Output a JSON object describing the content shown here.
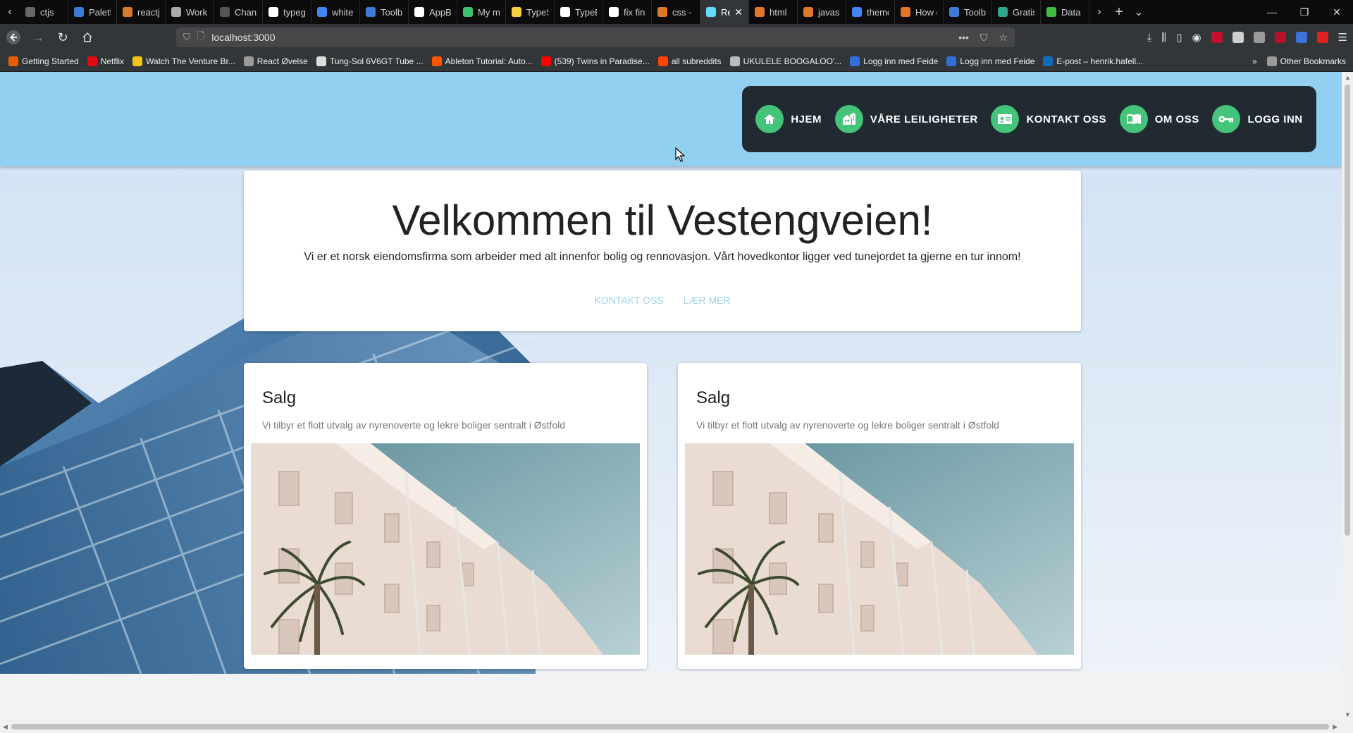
{
  "browser": {
    "tabs": [
      {
        "title": "ctjs",
        "color": "#666666"
      },
      {
        "title": "Palette",
        "color": "#3d7bd9"
      },
      {
        "title": "reactjs",
        "color": "#d97b2d"
      },
      {
        "title": "Work",
        "color": "#aaaaaa"
      },
      {
        "title": "Changelog",
        "color": "#555555"
      },
      {
        "title": "typeg",
        "color": "#ffffff"
      },
      {
        "title": "white",
        "color": "#4285f4"
      },
      {
        "title": "Toolb",
        "color": "#3d7bd9"
      },
      {
        "title": "AppB",
        "color": "#ffffff"
      },
      {
        "title": "My m",
        "color": "#3fbf6f"
      },
      {
        "title": "TypeS",
        "color": "#f5d142"
      },
      {
        "title": "TypeE",
        "color": "#ffffff"
      },
      {
        "title": "fix fin",
        "color": "#ffffff"
      },
      {
        "title": "css - h",
        "color": "#e0782a"
      },
      {
        "title": "Re",
        "color": "#61dafb",
        "active": true
      },
      {
        "title": "html",
        "color": "#e0782a"
      },
      {
        "title": "javasc",
        "color": "#e0782a"
      },
      {
        "title": "theme",
        "color": "#4285f4"
      },
      {
        "title": "How c",
        "color": "#e0782a"
      },
      {
        "title": "Toolb",
        "color": "#3d7bd9"
      },
      {
        "title": "Gratis",
        "color": "#2ea88a"
      },
      {
        "title": "Data |",
        "color": "#3fbf3f"
      }
    ],
    "url": "localhost:3000",
    "bookmarks": [
      {
        "label": "Getting Started",
        "color": "#e66000"
      },
      {
        "label": "Netflix",
        "color": "#e50914"
      },
      {
        "label": "Watch The Venture Br...",
        "color": "#f2c318"
      },
      {
        "label": "React Øvelse",
        "color": "#9a9a9a"
      },
      {
        "label": "Tung-Sol 6V6GT Tube ...",
        "color": "#dddddd"
      },
      {
        "label": "Ableton Tutorial: Auto...",
        "color": "#ff5500"
      },
      {
        "label": "(539) Twins in Paradise...",
        "color": "#ff0000"
      },
      {
        "label": "all subreddits",
        "color": "#ff4500"
      },
      {
        "label": "UKULELE BOOGALOO'...",
        "color": "#bbbbbb"
      },
      {
        "label": "Logg inn med Feide",
        "color": "#2f6fd6"
      },
      {
        "label": "Logg inn med Feide",
        "color": "#2f6fd6"
      },
      {
        "label": "E-post – henrik.hafell...",
        "color": "#0f6cbd"
      }
    ],
    "other_bookmarks": "Other Bookmarks"
  },
  "page": {
    "nav": [
      {
        "label": "HJEM",
        "icon": "home-icon"
      },
      {
        "label": "VÅRE LEILIGHETER",
        "icon": "apartments-icon"
      },
      {
        "label": "KONTAKT OSS",
        "icon": "contact-card-icon"
      },
      {
        "label": "OM OSS",
        "icon": "book-icon"
      },
      {
        "label": "LOGG INN",
        "icon": "key-icon"
      }
    ],
    "welcome": {
      "title": "Velkommen til Vestengveien!",
      "text": "Vi er et norsk eiendomsfirma som arbeider med alt innenfor bolig og rennovasjon. Vårt hovedkontor ligger ved tunejordet ta gjerne en tur innom!",
      "contact_label": "KONTAKT OSS",
      "more_label": "LÆR MER"
    },
    "cards": [
      {
        "title": "Salg",
        "text": "Vi tilbyr et flott utvalg av nyrenoverte og lekre boliger sentralt i Østfold"
      },
      {
        "title": "Salg",
        "text": "Vi tilbyr et flott utvalg av nyrenoverte og lekre boliger sentralt i Østfold"
      }
    ]
  },
  "colors": {
    "header_bg": "#93cff0",
    "nav_bg": "#212a31",
    "nav_icon_bg": "#44c37a",
    "link_text": "#9dd3ee"
  }
}
